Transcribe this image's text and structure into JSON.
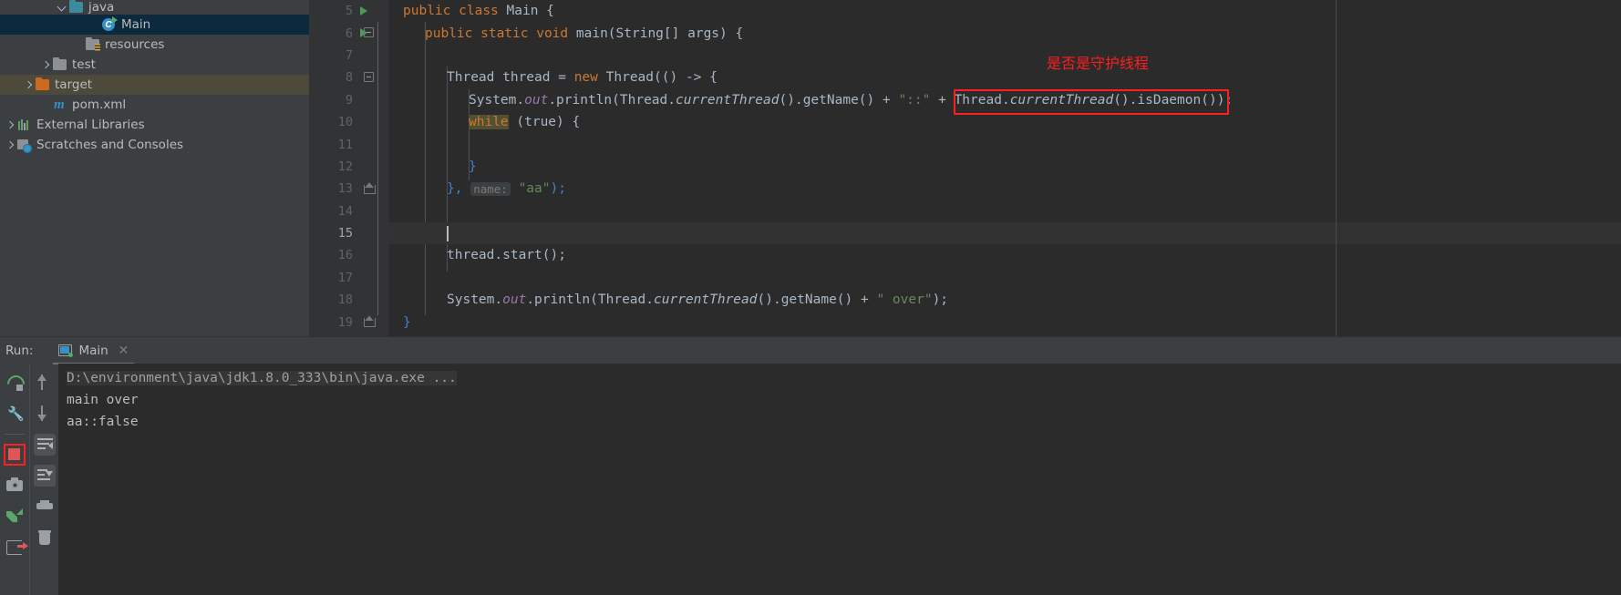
{
  "project_tree": {
    "items": [
      {
        "label": "java",
        "icon": "folder-teal-icon",
        "arrow": "down",
        "indent": 62,
        "state": "normal"
      },
      {
        "label": "Main",
        "icon": "java-class-icon",
        "arrow": "none",
        "indent": 98,
        "state": "selected"
      },
      {
        "label": "resources",
        "icon": "folder-resources-icon",
        "arrow": "none",
        "indent": 80,
        "state": "normal"
      },
      {
        "label": "test",
        "icon": "folder-grey-icon",
        "arrow": "right",
        "indent": 44,
        "state": "normal"
      },
      {
        "label": "target",
        "icon": "folder-orange-icon",
        "arrow": "right",
        "indent": 25,
        "state": "target"
      },
      {
        "label": "pom.xml",
        "icon": "maven-icon",
        "arrow": "none",
        "indent": 44,
        "state": "normal"
      },
      {
        "label": "External Libraries",
        "icon": "external-libraries-icon",
        "arrow": "right",
        "indent": 5,
        "state": "normal"
      },
      {
        "label": "Scratches and Consoles",
        "icon": "scratches-icon",
        "arrow": "right",
        "indent": 5,
        "state": "normal"
      }
    ]
  },
  "editor": {
    "lines": [
      {
        "num": "5",
        "run_arrow": true,
        "fold": "open",
        "caret": false
      },
      {
        "num": "6",
        "run_arrow": true,
        "fold": "open",
        "caret": false
      },
      {
        "num": "7",
        "run_arrow": false,
        "fold": "none",
        "caret": false
      },
      {
        "num": "8",
        "run_arrow": false,
        "fold": "open",
        "caret": false
      },
      {
        "num": "9",
        "run_arrow": false,
        "fold": "none",
        "caret": false
      },
      {
        "num": "10",
        "run_arrow": false,
        "fold": "none",
        "caret": false
      },
      {
        "num": "11",
        "run_arrow": false,
        "fold": "none",
        "caret": false
      },
      {
        "num": "12",
        "run_arrow": false,
        "fold": "none",
        "caret": false
      },
      {
        "num": "13",
        "run_arrow": false,
        "fold": "close",
        "caret": false
      },
      {
        "num": "14",
        "run_arrow": false,
        "fold": "none",
        "caret": false
      },
      {
        "num": "15",
        "run_arrow": false,
        "fold": "none",
        "caret": true
      },
      {
        "num": "16",
        "run_arrow": false,
        "fold": "none",
        "caret": false
      },
      {
        "num": "17",
        "run_arrow": false,
        "fold": "none",
        "caret": false
      },
      {
        "num": "18",
        "run_arrow": false,
        "fold": "none",
        "caret": false
      },
      {
        "num": "19",
        "run_arrow": false,
        "fold": "close",
        "caret": false
      }
    ],
    "code": {
      "l5_public": "public",
      "l5_class": "class",
      "l5_name": "Main",
      "l5_brace": "{",
      "l6": "public static void main(String[] args) {",
      "l8": "Thread thread = new Thread(() -> {",
      "l9_a": "System.",
      "l9_out": "out",
      "l9_b": ".println(Thread.",
      "l9_ct": "currentThread",
      "l9_c": "().getName() + ",
      "l9_str": "\"::\"",
      "l9_d": " + ",
      "l9_box_a": "Thread.",
      "l9_box_ct": "currentThread",
      "l9_box_b": "().isDaemon()",
      "l9_tail": ");",
      "l10_while": "while",
      "l10_rest": " (true) {",
      "l12": "}",
      "l13_a": "}, ",
      "l13_hint": "name:",
      "l13_str": "\"aa\"",
      "l13_tail": ");",
      "l16": "thread.start();",
      "l18_a": "System.",
      "l18_out": "out",
      "l18_b": ".println(Thread.",
      "l18_ct": "currentThread",
      "l18_c": "().getName() + ",
      "l18_str": "\" over\"",
      "l18_tail": ");",
      "l19": "}"
    },
    "annotation": {
      "text": "是否是守护线程",
      "color": "#ff1e1e"
    }
  },
  "run_panel": {
    "label": "Run:",
    "tab_title": "Main",
    "tab_close": "✕",
    "console_lines": [
      {
        "text": "D:\\environment\\java\\jdk1.8.0_333\\bin\\java.exe ...",
        "type": "cmd"
      },
      {
        "text": "main over",
        "type": "out"
      },
      {
        "text": "aa::false",
        "type": "out"
      }
    ],
    "toolbar_left": [
      {
        "name": "rerun-button",
        "glyph": "g-rerun"
      },
      {
        "name": "settings-wrench-button",
        "glyph": "g-wrench"
      },
      {
        "name": "stop-button",
        "glyph": "g-stop"
      },
      {
        "name": "screenshot-button",
        "glyph": "g-cam"
      },
      {
        "name": "thread-dump-button",
        "glyph": "g-thread"
      },
      {
        "name": "export-button",
        "glyph": "g-export"
      }
    ],
    "toolbar_right": [
      {
        "name": "up-arrow-button",
        "glyph": "g-arrow-up"
      },
      {
        "name": "down-arrow-button",
        "glyph": "g-arrow-dn"
      },
      {
        "name": "soft-wrap-button",
        "glyph": "g-wrap"
      },
      {
        "name": "scroll-to-end-button",
        "glyph": "g-scroll"
      },
      {
        "name": "print-button",
        "glyph": "g-print"
      },
      {
        "name": "clear-all-button",
        "glyph": "g-trash"
      }
    ]
  },
  "colors": {
    "editor_bg": "#2b2b2b",
    "panel_bg": "#3c3f41",
    "selection": "#0d293e",
    "target_row": "#4e4a3b",
    "annotation_red": "#ff1e1e",
    "keyword_orange": "#cc7832",
    "string_green": "#6a8759",
    "static_purple": "#9876aa"
  }
}
